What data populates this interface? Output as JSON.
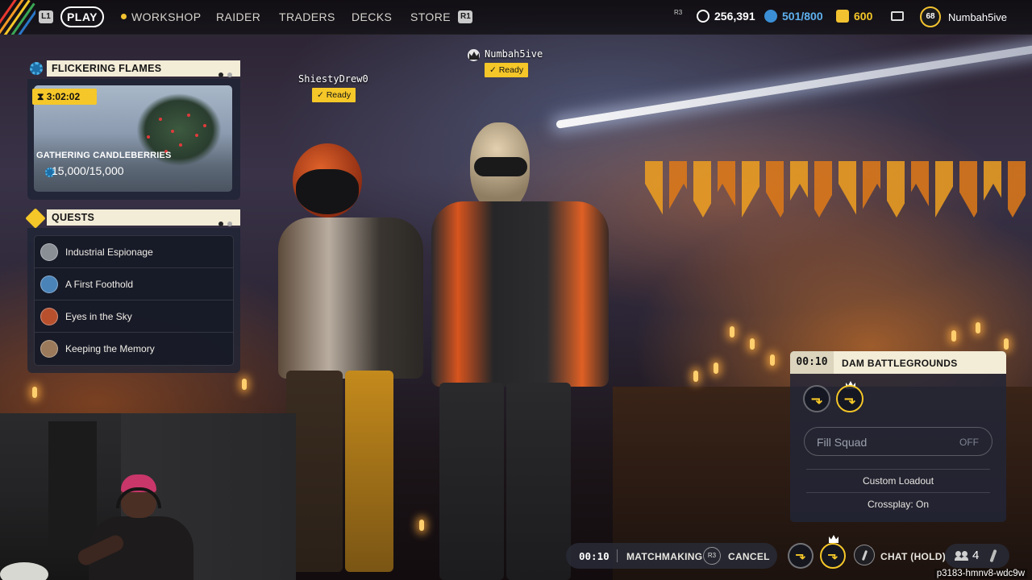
{
  "colors": {
    "accent_yellow": "#f5c728",
    "panel_header": "#f3ecd7",
    "panel_bg": "#1e2434",
    "rainbow_stripes": [
      "#e8392f",
      "#f39a24",
      "#f5c728",
      "#3aa655",
      "#2a78c7"
    ]
  },
  "topbar": {
    "left_hint": "L1",
    "right_hint": "R1",
    "play_label": "PLAY",
    "nav": [
      "WORKSHOP",
      "RAIDER",
      "TRADERS",
      "DECKS",
      "STORE"
    ],
    "r3_hint": "R3",
    "coins": "256,391",
    "currency2": "501/800",
    "currency3": "600",
    "level": "68",
    "username": "Numbah5ive"
  },
  "event": {
    "header": "FLICKERING FLAMES",
    "timer": "3:02:02",
    "title": "GATHERING CANDLEBERRIES",
    "progress": "15,000/15,000",
    "page_dots": 2,
    "active_dot": 0
  },
  "quests": {
    "header": "QUESTS",
    "items": [
      {
        "label": "Industrial Espionage",
        "avatar_color": "#8a8f96"
      },
      {
        "label": "A First Foothold",
        "avatar_color": "#4a83b8"
      },
      {
        "label": "Eyes in the Sky",
        "avatar_color": "#b8502e"
      },
      {
        "label": "Keeping the Memory",
        "avatar_color": "#9a7a5a"
      }
    ]
  },
  "players": [
    {
      "name": "ShiestyDrew0",
      "status": "Ready"
    },
    {
      "name": "Numbah5ive",
      "status": "Ready",
      "leader": true
    }
  ],
  "squad": {
    "time": "00:10",
    "map": "DAM BATTLEGROUNDS",
    "fill_label": "Fill Squad",
    "fill_state": "OFF",
    "loadout": "Custom Loadout",
    "crossplay": "Crossplay: On"
  },
  "matchmaking": {
    "time": "00:10",
    "label": "MATCHMAKING",
    "r3_hint": "R3",
    "cancel": "CANCEL",
    "chat": "CHAT (HOLD)",
    "party_count": "4"
  },
  "session_id": "p3183-hmnv8-wdc9w"
}
